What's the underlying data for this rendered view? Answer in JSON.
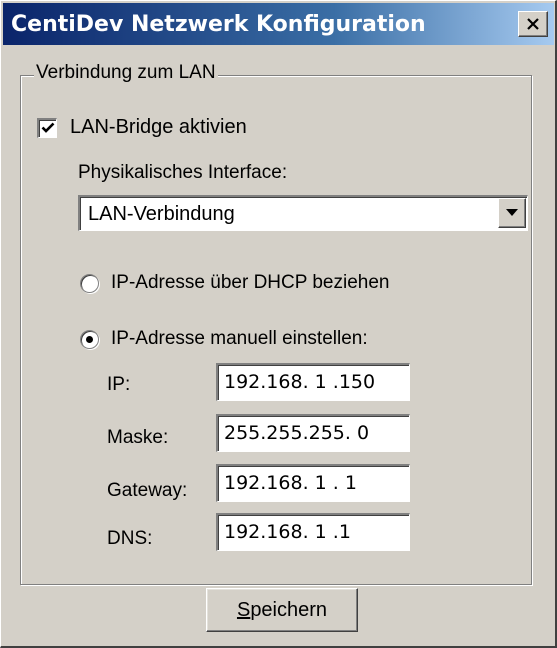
{
  "window": {
    "title": "CentiDev Netzwerk Konfiguration"
  },
  "group": {
    "legend": "Verbindung zum LAN"
  },
  "bridge": {
    "label": "LAN-Bridge aktivien",
    "checked": true
  },
  "interface": {
    "label": "Physikalisches Interface:",
    "selected": "LAN-Verbindung"
  },
  "mode": {
    "dhcp_label": "IP-Adresse über DHCP beziehen",
    "manual_label": "IP-Adresse manuell einstellen:",
    "selected": "manual"
  },
  "fields": [
    {
      "label": "IP:",
      "value": "192.168. 1 .150"
    },
    {
      "label": "Maske:",
      "value": "255.255.255. 0"
    },
    {
      "label": "Gateway:",
      "value": "192.168. 1 . 1"
    },
    {
      "label": "DNS:",
      "value": "192.168. 1 .1"
    }
  ],
  "save": {
    "mnemonic": "S",
    "rest": "peichern"
  },
  "colors": {
    "title_gradient_start": "#0a246a",
    "title_gradient_end": "#a6caf0",
    "face": "#d4d0c8"
  },
  "icons": {
    "close": "close-icon",
    "checkmark": "checkmark-icon",
    "dropdown": "chevron-down-icon"
  }
}
